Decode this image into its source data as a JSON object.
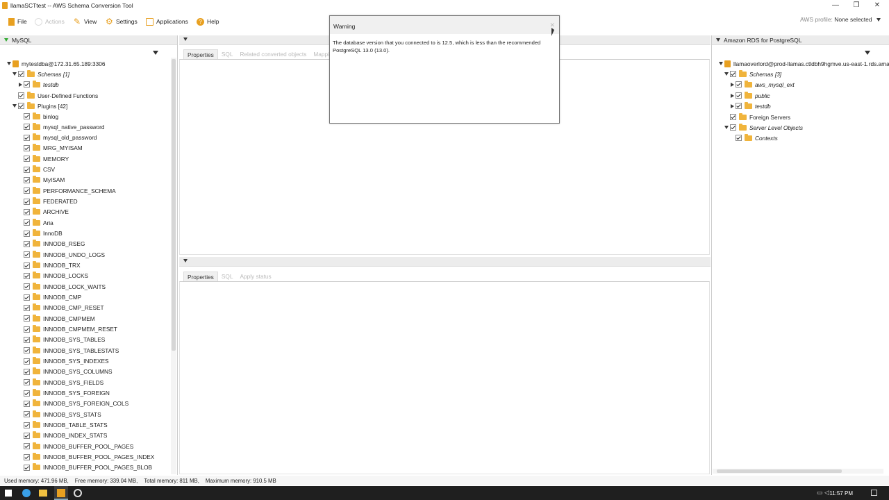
{
  "window": {
    "title": "llamaSCTtest  -- AWS Schema Conversion Tool",
    "min": "—",
    "restore": "❐",
    "close": "✕"
  },
  "menu": {
    "file": "File",
    "actions": "Actions",
    "view": "View",
    "settings": "Settings",
    "applications": "Applications",
    "help": "Help",
    "profile_label": "AWS profile:",
    "profile_value": "None selected"
  },
  "left": {
    "header": "MySQL",
    "connection": "mytestdba@172.31.65.189:3306",
    "schemas": "Schemas [1]",
    "testdb": "testdb",
    "udf": "User-Defined Functions",
    "plugins": "Plugins [42]",
    "plugin_items": [
      "binlog",
      "mysql_native_password",
      "mysql_old_password",
      "MRG_MYISAM",
      "MEMORY",
      "CSV",
      "MyISAM",
      "PERFORMANCE_SCHEMA",
      "FEDERATED",
      "ARCHIVE",
      "Aria",
      "InnoDB",
      "INNODB_RSEG",
      "INNODB_UNDO_LOGS",
      "INNODB_TRX",
      "INNODB_LOCKS",
      "INNODB_LOCK_WAITS",
      "INNODB_CMP",
      "INNODB_CMP_RESET",
      "INNODB_CMPMEM",
      "INNODB_CMPMEM_RESET",
      "INNODB_SYS_TABLES",
      "INNODB_SYS_TABLESTATS",
      "INNODB_SYS_INDEXES",
      "INNODB_SYS_COLUMNS",
      "INNODB_SYS_FIELDS",
      "INNODB_SYS_FOREIGN",
      "INNODB_SYS_FOREIGN_COLS",
      "INNODB_SYS_STATS",
      "INNODB_TABLE_STATS",
      "INNODB_INDEX_STATS",
      "INNODB_BUFFER_POOL_PAGES",
      "INNODB_BUFFER_POOL_PAGES_INDEX",
      "INNODB_BUFFER_POOL_PAGES_BLOB"
    ]
  },
  "right": {
    "header": "Amazon RDS for PostgreSQL",
    "connection": "llamaoverlord@prod-llamas.ctldbh9hgmve.us-east-1.rds.amaz",
    "schemas": "Schemas [3]",
    "aws_mysql_ext": "aws_mysql_ext",
    "public": "public",
    "testdb": "testdb",
    "foreign_servers": "Foreign Servers",
    "server_level": "Server Level Objects",
    "contexts": "Contexts"
  },
  "center": {
    "top_tabs": [
      "Properties",
      "SQL",
      "Related converted objects",
      "Mapping"
    ],
    "bottom_tabs": [
      "Properties",
      "SQL",
      "Apply status"
    ]
  },
  "dialog": {
    "title": "Warning",
    "close": "✕",
    "message": "The database version that you connected to is 12.5, which is less than the recommended PostgreSQL 13.0 (13.0)."
  },
  "status": {
    "used": "Used memory: 471.96 MB,",
    "free": "Free memory: 339.04 MB,",
    "total": "Total memory: 811 MB,",
    "max": "Maximum memory: 910.5 MB"
  },
  "taskbar": {
    "clock": "11:57 PM"
  }
}
